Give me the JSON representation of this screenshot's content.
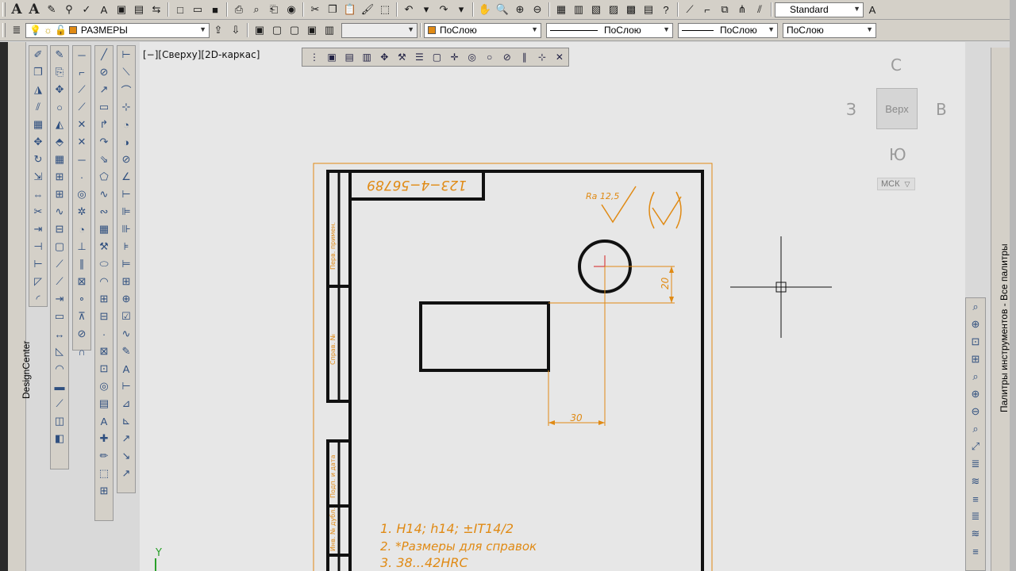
{
  "toolbar_top": {
    "text_style": "Standard"
  },
  "toolbar_layer": {
    "layer_name": "РАЗМЕРЫ",
    "color": "ПоСлою",
    "linetype": "ПоСлою",
    "lineweight": "ПоСлою",
    "plotstyle": "ПоСлою"
  },
  "viewport": {
    "label": "[−][Сверху][2D-каркас]"
  },
  "viewcube": {
    "north": "С",
    "south": "Ю",
    "west": "З",
    "east": "В",
    "face": "Верх",
    "ucs": "МСК"
  },
  "palettes": {
    "left_title": "DesignCenter",
    "right_title": "Палитры инструментов - Все палитры"
  },
  "drawing": {
    "doc_number": "123−4−56789",
    "roughness": "Ra 12,5",
    "dim_horizontal": "30",
    "dim_vertical": "20",
    "notes": [
      "1.  H14; h14; ±IT14/2",
      "2.  *Размеры для справок",
      "3.  38...42HRC"
    ],
    "ucs_y_label": "Y",
    "side_labels": [
      "Перв. примен.",
      "Справ. №",
      "Подп. и дата",
      "Инв. № дубл."
    ]
  },
  "colors": {
    "drawing_orange": "#e08a14",
    "frame_black": "#111111",
    "toolbar_bg": "#d4d0c8",
    "canvas_bg": "#e7e7e7",
    "crosshair_red": "#d42020"
  }
}
